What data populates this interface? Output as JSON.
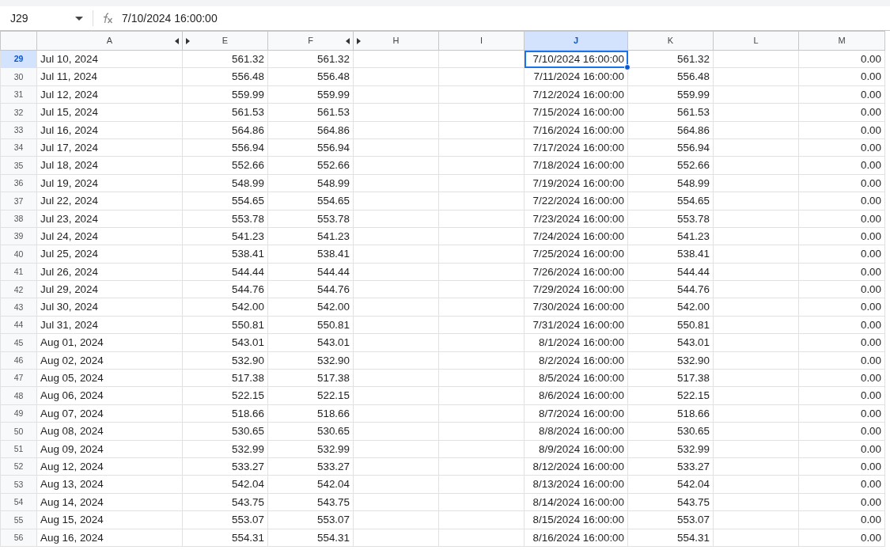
{
  "name_box": {
    "value": "J29"
  },
  "formula_bar": {
    "value": "7/10/2024 16:00:00"
  },
  "columns": [
    {
      "label": "A",
      "selected": false,
      "hidden_before": false,
      "hidden_after": true
    },
    {
      "label": "E",
      "selected": false,
      "hidden_before": true,
      "hidden_after": false
    },
    {
      "label": "F",
      "selected": false,
      "hidden_before": false,
      "hidden_after": true
    },
    {
      "label": "H",
      "selected": false,
      "hidden_before": true,
      "hidden_after": false
    },
    {
      "label": "I",
      "selected": false,
      "hidden_before": false,
      "hidden_after": false
    },
    {
      "label": "J",
      "selected": true,
      "hidden_before": false,
      "hidden_after": false
    },
    {
      "label": "K",
      "selected": false,
      "hidden_before": false,
      "hidden_after": false
    },
    {
      "label": "L",
      "selected": false,
      "hidden_before": false,
      "hidden_after": false
    },
    {
      "label": "M",
      "selected": false,
      "hidden_before": false,
      "hidden_after": false
    }
  ],
  "rows": [
    {
      "number": "29",
      "selected": true,
      "a": "Jul 10, 2024",
      "e": "561.32",
      "f": "561.32",
      "j": "7/10/2024 16:00:00",
      "k": "561.32",
      "m": "0.00"
    },
    {
      "number": "30",
      "selected": false,
      "a": "Jul 11, 2024",
      "e": "556.48",
      "f": "556.48",
      "j": "7/11/2024 16:00:00",
      "k": "556.48",
      "m": "0.00"
    },
    {
      "number": "31",
      "selected": false,
      "a": "Jul 12, 2024",
      "e": "559.99",
      "f": "559.99",
      "j": "7/12/2024 16:00:00",
      "k": "559.99",
      "m": "0.00"
    },
    {
      "number": "32",
      "selected": false,
      "a": "Jul 15, 2024",
      "e": "561.53",
      "f": "561.53",
      "j": "7/15/2024 16:00:00",
      "k": "561.53",
      "m": "0.00"
    },
    {
      "number": "33",
      "selected": false,
      "a": "Jul 16, 2024",
      "e": "564.86",
      "f": "564.86",
      "j": "7/16/2024 16:00:00",
      "k": "564.86",
      "m": "0.00"
    },
    {
      "number": "34",
      "selected": false,
      "a": "Jul 17, 2024",
      "e": "556.94",
      "f": "556.94",
      "j": "7/17/2024 16:00:00",
      "k": "556.94",
      "m": "0.00"
    },
    {
      "number": "35",
      "selected": false,
      "a": "Jul 18, 2024",
      "e": "552.66",
      "f": "552.66",
      "j": "7/18/2024 16:00:00",
      "k": "552.66",
      "m": "0.00"
    },
    {
      "number": "36",
      "selected": false,
      "a": "Jul 19, 2024",
      "e": "548.99",
      "f": "548.99",
      "j": "7/19/2024 16:00:00",
      "k": "548.99",
      "m": "0.00"
    },
    {
      "number": "37",
      "selected": false,
      "a": "Jul 22, 2024",
      "e": "554.65",
      "f": "554.65",
      "j": "7/22/2024 16:00:00",
      "k": "554.65",
      "m": "0.00"
    },
    {
      "number": "38",
      "selected": false,
      "a": "Jul 23, 2024",
      "e": "553.78",
      "f": "553.78",
      "j": "7/23/2024 16:00:00",
      "k": "553.78",
      "m": "0.00"
    },
    {
      "number": "39",
      "selected": false,
      "a": "Jul 24, 2024",
      "e": "541.23",
      "f": "541.23",
      "j": "7/24/2024 16:00:00",
      "k": "541.23",
      "m": "0.00"
    },
    {
      "number": "40",
      "selected": false,
      "a": "Jul 25, 2024",
      "e": "538.41",
      "f": "538.41",
      "j": "7/25/2024 16:00:00",
      "k": "538.41",
      "m": "0.00"
    },
    {
      "number": "41",
      "selected": false,
      "a": "Jul 26, 2024",
      "e": "544.44",
      "f": "544.44",
      "j": "7/26/2024 16:00:00",
      "k": "544.44",
      "m": "0.00"
    },
    {
      "number": "42",
      "selected": false,
      "a": "Jul 29, 2024",
      "e": "544.76",
      "f": "544.76",
      "j": "7/29/2024 16:00:00",
      "k": "544.76",
      "m": "0.00"
    },
    {
      "number": "43",
      "selected": false,
      "a": "Jul 30, 2024",
      "e": "542.00",
      "f": "542.00",
      "j": "7/30/2024 16:00:00",
      "k": "542.00",
      "m": "0.00"
    },
    {
      "number": "44",
      "selected": false,
      "a": "Jul 31, 2024",
      "e": "550.81",
      "f": "550.81",
      "j": "7/31/2024 16:00:00",
      "k": "550.81",
      "m": "0.00"
    },
    {
      "number": "45",
      "selected": false,
      "a": "Aug 01, 2024",
      "e": "543.01",
      "f": "543.01",
      "j": "8/1/2024 16:00:00",
      "k": "543.01",
      "m": "0.00"
    },
    {
      "number": "46",
      "selected": false,
      "a": "Aug 02, 2024",
      "e": "532.90",
      "f": "532.90",
      "j": "8/2/2024 16:00:00",
      "k": "532.90",
      "m": "0.00"
    },
    {
      "number": "47",
      "selected": false,
      "a": "Aug 05, 2024",
      "e": "517.38",
      "f": "517.38",
      "j": "8/5/2024 16:00:00",
      "k": "517.38",
      "m": "0.00"
    },
    {
      "number": "48",
      "selected": false,
      "a": "Aug 06, 2024",
      "e": "522.15",
      "f": "522.15",
      "j": "8/6/2024 16:00:00",
      "k": "522.15",
      "m": "0.00"
    },
    {
      "number": "49",
      "selected": false,
      "a": "Aug 07, 2024",
      "e": "518.66",
      "f": "518.66",
      "j": "8/7/2024 16:00:00",
      "k": "518.66",
      "m": "0.00"
    },
    {
      "number": "50",
      "selected": false,
      "a": "Aug 08, 2024",
      "e": "530.65",
      "f": "530.65",
      "j": "8/8/2024 16:00:00",
      "k": "530.65",
      "m": "0.00"
    },
    {
      "number": "51",
      "selected": false,
      "a": "Aug 09, 2024",
      "e": "532.99",
      "f": "532.99",
      "j": "8/9/2024 16:00:00",
      "k": "532.99",
      "m": "0.00"
    },
    {
      "number": "52",
      "selected": false,
      "a": "Aug 12, 2024",
      "e": "533.27",
      "f": "533.27",
      "j": "8/12/2024 16:00:00",
      "k": "533.27",
      "m": "0.00"
    },
    {
      "number": "53",
      "selected": false,
      "a": "Aug 13, 2024",
      "e": "542.04",
      "f": "542.04",
      "j": "8/13/2024 16:00:00",
      "k": "542.04",
      "m": "0.00"
    },
    {
      "number": "54",
      "selected": false,
      "a": "Aug 14, 2024",
      "e": "543.75",
      "f": "543.75",
      "j": "8/14/2024 16:00:00",
      "k": "543.75",
      "m": "0.00"
    },
    {
      "number": "55",
      "selected": false,
      "a": "Aug 15, 2024",
      "e": "553.07",
      "f": "553.07",
      "j": "8/15/2024 16:00:00",
      "k": "553.07",
      "m": "0.00"
    },
    {
      "number": "56",
      "selected": false,
      "a": "Aug 16, 2024",
      "e": "554.31",
      "f": "554.31",
      "j": "8/16/2024 16:00:00",
      "k": "554.31",
      "m": "0.00"
    }
  ]
}
